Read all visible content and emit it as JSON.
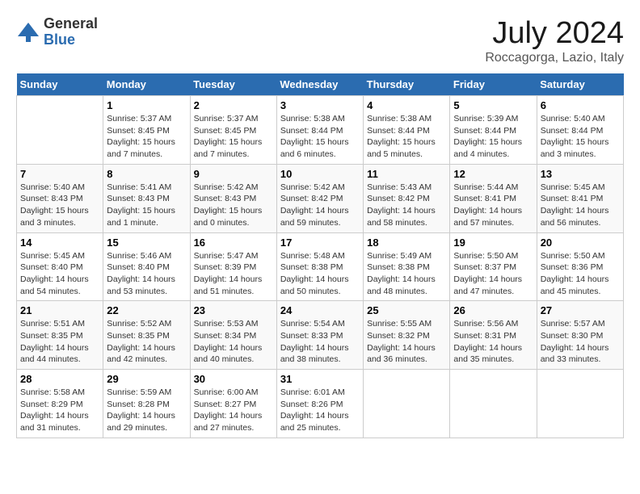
{
  "header": {
    "logo_general": "General",
    "logo_blue": "Blue",
    "month_title": "July 2024",
    "location": "Roccagorga, Lazio, Italy"
  },
  "days_of_week": [
    "Sunday",
    "Monday",
    "Tuesday",
    "Wednesday",
    "Thursday",
    "Friday",
    "Saturday"
  ],
  "weeks": [
    [
      {
        "day": "",
        "info": ""
      },
      {
        "day": "1",
        "info": "Sunrise: 5:37 AM\nSunset: 8:45 PM\nDaylight: 15 hours\nand 7 minutes."
      },
      {
        "day": "2",
        "info": "Sunrise: 5:37 AM\nSunset: 8:45 PM\nDaylight: 15 hours\nand 7 minutes."
      },
      {
        "day": "3",
        "info": "Sunrise: 5:38 AM\nSunset: 8:44 PM\nDaylight: 15 hours\nand 6 minutes."
      },
      {
        "day": "4",
        "info": "Sunrise: 5:38 AM\nSunset: 8:44 PM\nDaylight: 15 hours\nand 5 minutes."
      },
      {
        "day": "5",
        "info": "Sunrise: 5:39 AM\nSunset: 8:44 PM\nDaylight: 15 hours\nand 4 minutes."
      },
      {
        "day": "6",
        "info": "Sunrise: 5:40 AM\nSunset: 8:44 PM\nDaylight: 15 hours\nand 3 minutes."
      }
    ],
    [
      {
        "day": "7",
        "info": "Sunrise: 5:40 AM\nSunset: 8:43 PM\nDaylight: 15 hours\nand 3 minutes."
      },
      {
        "day": "8",
        "info": "Sunrise: 5:41 AM\nSunset: 8:43 PM\nDaylight: 15 hours\nand 1 minute."
      },
      {
        "day": "9",
        "info": "Sunrise: 5:42 AM\nSunset: 8:43 PM\nDaylight: 15 hours\nand 0 minutes."
      },
      {
        "day": "10",
        "info": "Sunrise: 5:42 AM\nSunset: 8:42 PM\nDaylight: 14 hours\nand 59 minutes."
      },
      {
        "day": "11",
        "info": "Sunrise: 5:43 AM\nSunset: 8:42 PM\nDaylight: 14 hours\nand 58 minutes."
      },
      {
        "day": "12",
        "info": "Sunrise: 5:44 AM\nSunset: 8:41 PM\nDaylight: 14 hours\nand 57 minutes."
      },
      {
        "day": "13",
        "info": "Sunrise: 5:45 AM\nSunset: 8:41 PM\nDaylight: 14 hours\nand 56 minutes."
      }
    ],
    [
      {
        "day": "14",
        "info": "Sunrise: 5:45 AM\nSunset: 8:40 PM\nDaylight: 14 hours\nand 54 minutes."
      },
      {
        "day": "15",
        "info": "Sunrise: 5:46 AM\nSunset: 8:40 PM\nDaylight: 14 hours\nand 53 minutes."
      },
      {
        "day": "16",
        "info": "Sunrise: 5:47 AM\nSunset: 8:39 PM\nDaylight: 14 hours\nand 51 minutes."
      },
      {
        "day": "17",
        "info": "Sunrise: 5:48 AM\nSunset: 8:38 PM\nDaylight: 14 hours\nand 50 minutes."
      },
      {
        "day": "18",
        "info": "Sunrise: 5:49 AM\nSunset: 8:38 PM\nDaylight: 14 hours\nand 48 minutes."
      },
      {
        "day": "19",
        "info": "Sunrise: 5:50 AM\nSunset: 8:37 PM\nDaylight: 14 hours\nand 47 minutes."
      },
      {
        "day": "20",
        "info": "Sunrise: 5:50 AM\nSunset: 8:36 PM\nDaylight: 14 hours\nand 45 minutes."
      }
    ],
    [
      {
        "day": "21",
        "info": "Sunrise: 5:51 AM\nSunset: 8:35 PM\nDaylight: 14 hours\nand 44 minutes."
      },
      {
        "day": "22",
        "info": "Sunrise: 5:52 AM\nSunset: 8:35 PM\nDaylight: 14 hours\nand 42 minutes."
      },
      {
        "day": "23",
        "info": "Sunrise: 5:53 AM\nSunset: 8:34 PM\nDaylight: 14 hours\nand 40 minutes."
      },
      {
        "day": "24",
        "info": "Sunrise: 5:54 AM\nSunset: 8:33 PM\nDaylight: 14 hours\nand 38 minutes."
      },
      {
        "day": "25",
        "info": "Sunrise: 5:55 AM\nSunset: 8:32 PM\nDaylight: 14 hours\nand 36 minutes."
      },
      {
        "day": "26",
        "info": "Sunrise: 5:56 AM\nSunset: 8:31 PM\nDaylight: 14 hours\nand 35 minutes."
      },
      {
        "day": "27",
        "info": "Sunrise: 5:57 AM\nSunset: 8:30 PM\nDaylight: 14 hours\nand 33 minutes."
      }
    ],
    [
      {
        "day": "28",
        "info": "Sunrise: 5:58 AM\nSunset: 8:29 PM\nDaylight: 14 hours\nand 31 minutes."
      },
      {
        "day": "29",
        "info": "Sunrise: 5:59 AM\nSunset: 8:28 PM\nDaylight: 14 hours\nand 29 minutes."
      },
      {
        "day": "30",
        "info": "Sunrise: 6:00 AM\nSunset: 8:27 PM\nDaylight: 14 hours\nand 27 minutes."
      },
      {
        "day": "31",
        "info": "Sunrise: 6:01 AM\nSunset: 8:26 PM\nDaylight: 14 hours\nand 25 minutes."
      },
      {
        "day": "",
        "info": ""
      },
      {
        "day": "",
        "info": ""
      },
      {
        "day": "",
        "info": ""
      }
    ]
  ]
}
